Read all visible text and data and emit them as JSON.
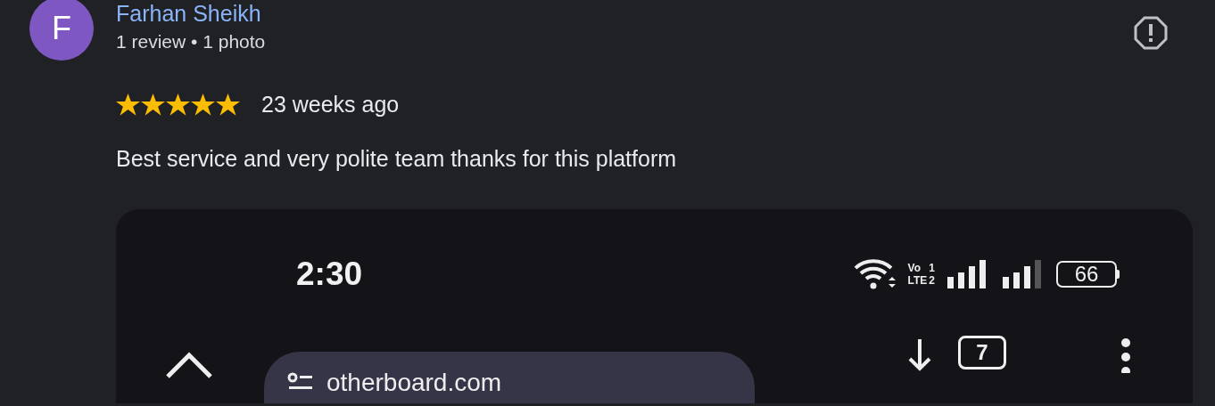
{
  "review": {
    "avatar": {
      "initial": "F",
      "color": "#7e57c2"
    },
    "name": "Farhan Sheikh",
    "meta": "1 review • 1 photo",
    "stars": 5,
    "time": "23 weeks ago",
    "text": "Best service and very polite team thanks for this platform"
  },
  "photo": {
    "time": "2:30",
    "network": [
      "Vo",
      "1",
      "LTE",
      "2"
    ],
    "battery": "66",
    "url": "otherboard.com",
    "tab_count": "7"
  }
}
